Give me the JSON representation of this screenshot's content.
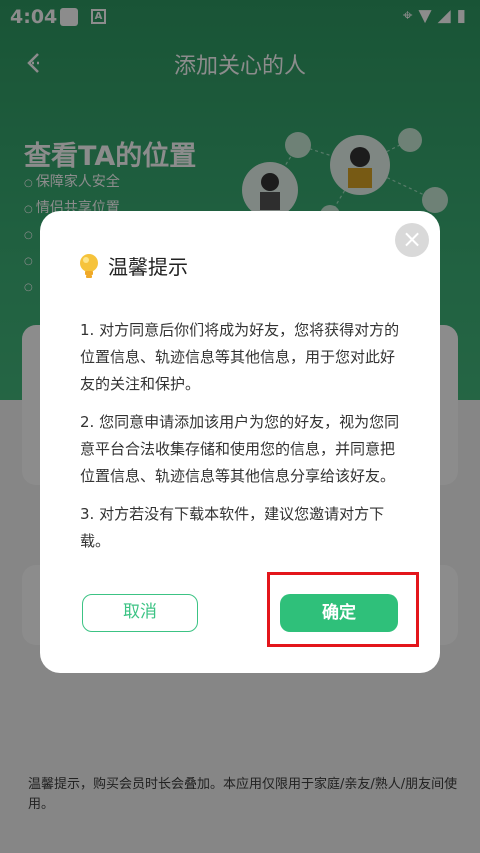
{
  "status_bar": {
    "time": "4:04",
    "a_icon": "A",
    "icons": [
      "location-icon",
      "wifi-icon",
      "signal-icon",
      "battery-icon"
    ]
  },
  "header": {
    "back_icon": "back-arrow-icon",
    "title": "添加关心的人"
  },
  "hero": {
    "title": "查看TA的位置",
    "items": [
      "保障家人安全",
      "情侣共享位置",
      "",
      "",
      ""
    ]
  },
  "dialog": {
    "title": "温馨提示",
    "icon": "lightbulb-icon",
    "paragraphs": [
      "1. 对方同意后你们将成为好友，您将获得对方的位置信息、轨迹信息等其他信息，用于您对此好友的关注和保护。",
      "2. 您同意申请添加该用户为您的好友，视为您同意平台合法收集存储和使用您的信息，并同意把位置信息、轨迹信息等其他信息分享给该好友。",
      "3. 对方若没有下载本软件，建议您邀请对方下载。"
    ],
    "cancel_label": "取消",
    "confirm_label": "确定",
    "close_icon": "close-icon"
  },
  "footer": {
    "tip": "温馨提示，购买会员时长会叠加。本应用仅限用于家庭/亲友/熟人/朋友间使用。"
  },
  "colors": {
    "accent": "#2fc07a",
    "header_green": "#3bb076",
    "highlight": "#e3151b"
  }
}
